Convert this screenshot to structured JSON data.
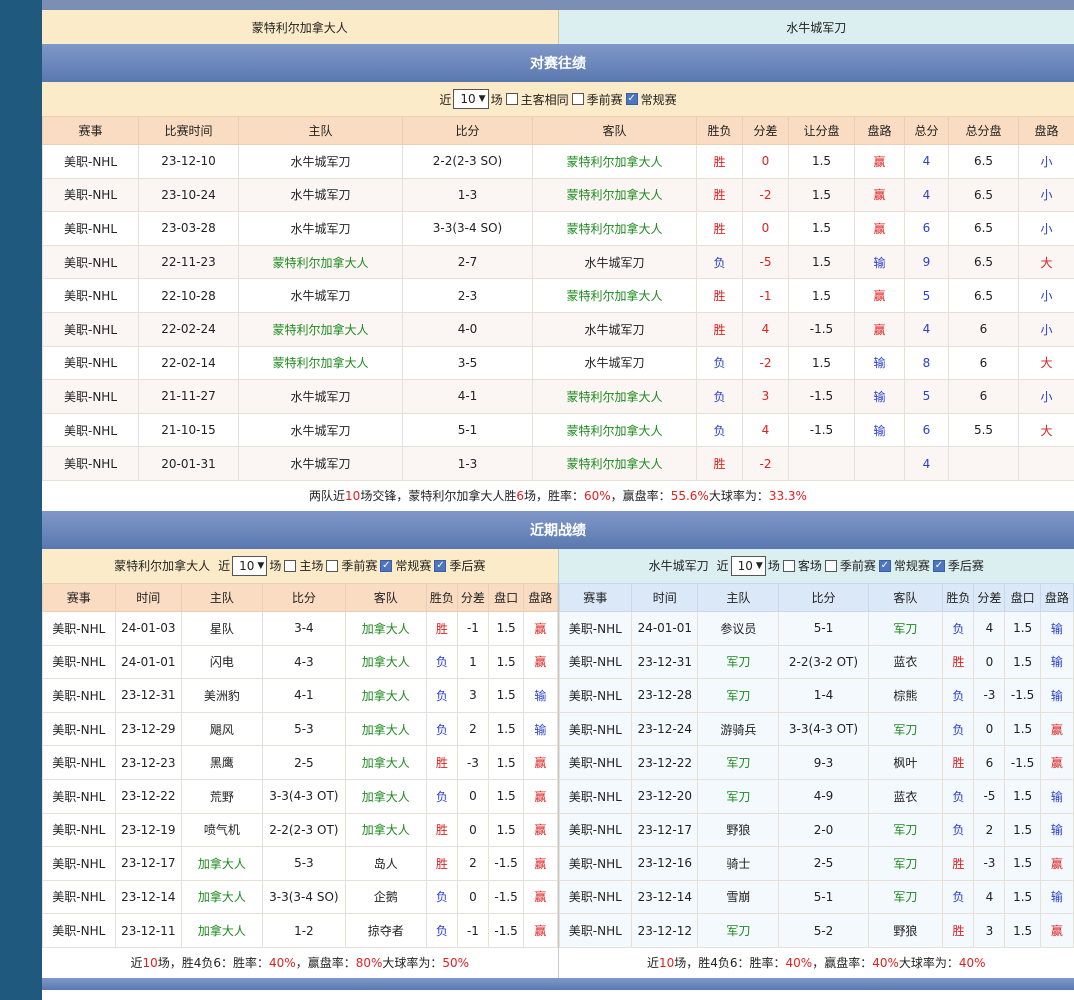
{
  "header": {
    "home": "蒙特利尔加拿大人",
    "away": "水牛城军刀"
  },
  "h2h": {
    "title": "对赛往绩",
    "filter": {
      "prefix": "近",
      "count": "10",
      "suffix": "场",
      "same": "主客相同",
      "pre": "季前赛",
      "regular": "常规赛"
    },
    "columns": [
      "赛事",
      "比赛时间",
      "主队",
      "比分",
      "客队",
      "胜负",
      "分差",
      "让分盘",
      "盘路",
      "总分",
      "总分盘",
      "盘路"
    ],
    "rows": [
      {
        "league": "美职-NHL",
        "date": "23-12-10",
        "home": "水牛城军刀",
        "hc": "",
        "score": "2-2(2-3 SO)",
        "away": "蒙特利尔加拿大人",
        "ac": "g",
        "res": "胜",
        "rc": "r",
        "diff": "0",
        "dc": "r",
        "line": "1.5",
        "pan": "赢",
        "pc": "r",
        "total": "4",
        "tl": "6.5",
        "ou": "小",
        "oc": "b"
      },
      {
        "league": "美职-NHL",
        "date": "23-10-24",
        "home": "水牛城军刀",
        "hc": "",
        "score": "1-3",
        "away": "蒙特利尔加拿大人",
        "ac": "g",
        "res": "胜",
        "rc": "r",
        "diff": "-2",
        "dc": "r",
        "line": "1.5",
        "pan": "赢",
        "pc": "r",
        "total": "4",
        "tl": "6.5",
        "ou": "小",
        "oc": "b"
      },
      {
        "league": "美职-NHL",
        "date": "23-03-28",
        "home": "水牛城军刀",
        "hc": "",
        "score": "3-3(3-4 SO)",
        "away": "蒙特利尔加拿大人",
        "ac": "g",
        "res": "胜",
        "rc": "r",
        "diff": "0",
        "dc": "r",
        "line": "1.5",
        "pan": "赢",
        "pc": "r",
        "total": "6",
        "tl": "6.5",
        "ou": "小",
        "oc": "b"
      },
      {
        "league": "美职-NHL",
        "date": "22-11-23",
        "home": "蒙特利尔加拿大人",
        "hc": "g",
        "score": "2-7",
        "away": "水牛城军刀",
        "ac": "",
        "res": "负",
        "rc": "b",
        "diff": "-5",
        "dc": "r",
        "line": "1.5",
        "pan": "输",
        "pc": "b",
        "total": "9",
        "tl": "6.5",
        "ou": "大",
        "oc": "r"
      },
      {
        "league": "美职-NHL",
        "date": "22-10-28",
        "home": "水牛城军刀",
        "hc": "",
        "score": "2-3",
        "away": "蒙特利尔加拿大人",
        "ac": "g",
        "res": "胜",
        "rc": "r",
        "diff": "-1",
        "dc": "r",
        "line": "1.5",
        "pan": "赢",
        "pc": "r",
        "total": "5",
        "tl": "6.5",
        "ou": "小",
        "oc": "b"
      },
      {
        "league": "美职-NHL",
        "date": "22-02-24",
        "home": "蒙特利尔加拿大人",
        "hc": "g",
        "score": "4-0",
        "away": "水牛城军刀",
        "ac": "",
        "res": "胜",
        "rc": "r",
        "diff": "4",
        "dc": "r",
        "line": "-1.5",
        "pan": "赢",
        "pc": "r",
        "total": "4",
        "tl": "6",
        "ou": "小",
        "oc": "b"
      },
      {
        "league": "美职-NHL",
        "date": "22-02-14",
        "home": "蒙特利尔加拿大人",
        "hc": "g",
        "score": "3-5",
        "away": "水牛城军刀",
        "ac": "",
        "res": "负",
        "rc": "b",
        "diff": "-2",
        "dc": "r",
        "line": "1.5",
        "pan": "输",
        "pc": "b",
        "total": "8",
        "tl": "6",
        "ou": "大",
        "oc": "r"
      },
      {
        "league": "美职-NHL",
        "date": "21-11-27",
        "home": "水牛城军刀",
        "hc": "",
        "score": "4-1",
        "away": "蒙特利尔加拿大人",
        "ac": "g",
        "res": "负",
        "rc": "b",
        "diff": "3",
        "dc": "r",
        "line": "-1.5",
        "pan": "输",
        "pc": "b",
        "total": "5",
        "tl": "6",
        "ou": "小",
        "oc": "b"
      },
      {
        "league": "美职-NHL",
        "date": "21-10-15",
        "home": "水牛城军刀",
        "hc": "",
        "score": "5-1",
        "away": "蒙特利尔加拿大人",
        "ac": "g",
        "res": "负",
        "rc": "b",
        "diff": "4",
        "dc": "r",
        "line": "-1.5",
        "pan": "输",
        "pc": "b",
        "total": "6",
        "tl": "5.5",
        "ou": "大",
        "oc": "r"
      },
      {
        "league": "美职-NHL",
        "date": "20-01-31",
        "home": "水牛城军刀",
        "hc": "",
        "score": "1-3",
        "away": "蒙特利尔加拿大人",
        "ac": "g",
        "res": "胜",
        "rc": "r",
        "diff": "-2",
        "dc": "r",
        "line": "",
        "pan": "",
        "pc": "",
        "total": "4",
        "tl": "",
        "ou": "",
        "oc": ""
      }
    ],
    "summary": {
      "a": "两队近",
      "n": "10",
      "b": "场交锋，蒙特利尔加拿大人胜",
      "w": "6",
      "c": "场，胜率：",
      "wr": "60%",
      "d": "，赢盘率：",
      "pr": "55.6%",
      "e": " 大球率为：",
      "br": "33.3%"
    }
  },
  "recent": {
    "title": "近期战绩",
    "columns": [
      "赛事",
      "时间",
      "主队",
      "比分",
      "客队",
      "胜负",
      "分差",
      "盘口",
      "盘路"
    ],
    "home": {
      "filter": {
        "team": "蒙特利尔加拿大人",
        "prefix": "近",
        "count": "10",
        "suffix": "场",
        "venue": "主场",
        "pre": "季前赛",
        "regular": "常规赛",
        "post": "季后赛"
      },
      "rows": [
        {
          "league": "美职-NHL",
          "date": "24-01-03",
          "home": "星队",
          "hc": "",
          "score": "3-4",
          "away": "加拿大人",
          "ac": "g",
          "res": "胜",
          "rc": "r",
          "diff": "-1",
          "line": "1.5",
          "pan": "赢",
          "pc": "r"
        },
        {
          "league": "美职-NHL",
          "date": "24-01-01",
          "home": "闪电",
          "hc": "",
          "score": "4-3",
          "away": "加拿大人",
          "ac": "g",
          "res": "负",
          "rc": "b",
          "diff": "1",
          "line": "1.5",
          "pan": "赢",
          "pc": "r"
        },
        {
          "league": "美职-NHL",
          "date": "23-12-31",
          "home": "美洲豹",
          "hc": "",
          "score": "4-1",
          "away": "加拿大人",
          "ac": "g",
          "res": "负",
          "rc": "b",
          "diff": "3",
          "line": "1.5",
          "pan": "输",
          "pc": "b"
        },
        {
          "league": "美职-NHL",
          "date": "23-12-29",
          "home": "飓风",
          "hc": "",
          "score": "5-3",
          "away": "加拿大人",
          "ac": "g",
          "res": "负",
          "rc": "b",
          "diff": "2",
          "line": "1.5",
          "pan": "输",
          "pc": "b"
        },
        {
          "league": "美职-NHL",
          "date": "23-12-23",
          "home": "黑鹰",
          "hc": "",
          "score": "2-5",
          "away": "加拿大人",
          "ac": "g",
          "res": "胜",
          "rc": "r",
          "diff": "-3",
          "line": "1.5",
          "pan": "赢",
          "pc": "r"
        },
        {
          "league": "美职-NHL",
          "date": "23-12-22",
          "home": "荒野",
          "hc": "",
          "score": "3-3(4-3 OT)",
          "away": "加拿大人",
          "ac": "g",
          "res": "负",
          "rc": "b",
          "diff": "0",
          "line": "1.5",
          "pan": "赢",
          "pc": "r"
        },
        {
          "league": "美职-NHL",
          "date": "23-12-19",
          "home": "喷气机",
          "hc": "",
          "score": "2-2(2-3 OT)",
          "away": "加拿大人",
          "ac": "g",
          "res": "胜",
          "rc": "r",
          "diff": "0",
          "line": "1.5",
          "pan": "赢",
          "pc": "r"
        },
        {
          "league": "美职-NHL",
          "date": "23-12-17",
          "home": "加拿大人",
          "hc": "g",
          "score": "5-3",
          "away": "岛人",
          "ac": "",
          "res": "胜",
          "rc": "r",
          "diff": "2",
          "line": "-1.5",
          "pan": "赢",
          "pc": "r"
        },
        {
          "league": "美职-NHL",
          "date": "23-12-14",
          "home": "加拿大人",
          "hc": "g",
          "score": "3-3(3-4 SO)",
          "away": "企鹅",
          "ac": "",
          "res": "负",
          "rc": "b",
          "diff": "0",
          "line": "-1.5",
          "pan": "赢",
          "pc": "r"
        },
        {
          "league": "美职-NHL",
          "date": "23-12-11",
          "home": "加拿大人",
          "hc": "g",
          "score": "1-2",
          "away": "掠夺者",
          "ac": "",
          "res": "负",
          "rc": "b",
          "diff": "-1",
          "line": "-1.5",
          "pan": "赢",
          "pc": "r"
        }
      ],
      "summary": {
        "a": "近",
        "n": "10",
        "b": "场，胜4负6：胜率：",
        "wr": "40%",
        "c": "，赢盘率：",
        "pr": "80%",
        "d": " 大球率为：",
        "br": "50%"
      }
    },
    "away": {
      "filter": {
        "team": "水牛城军刀",
        "prefix": "近",
        "count": "10",
        "suffix": "场",
        "venue": "客场",
        "pre": "季前赛",
        "regular": "常规赛",
        "post": "季后赛"
      },
      "rows": [
        {
          "league": "美职-NHL",
          "date": "24-01-01",
          "home": "参议员",
          "hc": "",
          "score": "5-1",
          "away": "军刀",
          "ac": "g",
          "res": "负",
          "rc": "b",
          "diff": "4",
          "line": "1.5",
          "pan": "输",
          "pc": "b"
        },
        {
          "league": "美职-NHL",
          "date": "23-12-31",
          "home": "军刀",
          "hc": "g",
          "score": "2-2(3-2 OT)",
          "away": "蓝衣",
          "ac": "",
          "res": "胜",
          "rc": "r",
          "diff": "0",
          "line": "1.5",
          "pan": "输",
          "pc": "b"
        },
        {
          "league": "美职-NHL",
          "date": "23-12-28",
          "home": "军刀",
          "hc": "g",
          "score": "1-4",
          "away": "棕熊",
          "ac": "",
          "res": "负",
          "rc": "b",
          "diff": "-3",
          "line": "-1.5",
          "pan": "输",
          "pc": "b"
        },
        {
          "league": "美职-NHL",
          "date": "23-12-24",
          "home": "游骑兵",
          "hc": "",
          "score": "3-3(4-3 OT)",
          "away": "军刀",
          "ac": "g",
          "res": "负",
          "rc": "b",
          "diff": "0",
          "line": "1.5",
          "pan": "赢",
          "pc": "r"
        },
        {
          "league": "美职-NHL",
          "date": "23-12-22",
          "home": "军刀",
          "hc": "g",
          "score": "9-3",
          "away": "枫叶",
          "ac": "",
          "res": "胜",
          "rc": "r",
          "diff": "6",
          "line": "-1.5",
          "pan": "赢",
          "pc": "r"
        },
        {
          "league": "美职-NHL",
          "date": "23-12-20",
          "home": "军刀",
          "hc": "g",
          "score": "4-9",
          "away": "蓝衣",
          "ac": "",
          "res": "负",
          "rc": "b",
          "diff": "-5",
          "line": "1.5",
          "pan": "输",
          "pc": "b"
        },
        {
          "league": "美职-NHL",
          "date": "23-12-17",
          "home": "野狼",
          "hc": "",
          "score": "2-0",
          "away": "军刀",
          "ac": "g",
          "res": "负",
          "rc": "b",
          "diff": "2",
          "line": "1.5",
          "pan": "输",
          "pc": "b"
        },
        {
          "league": "美职-NHL",
          "date": "23-12-16",
          "home": "骑士",
          "hc": "",
          "score": "2-5",
          "away": "军刀",
          "ac": "g",
          "res": "胜",
          "rc": "r",
          "diff": "-3",
          "line": "1.5",
          "pan": "赢",
          "pc": "r"
        },
        {
          "league": "美职-NHL",
          "date": "23-12-14",
          "home": "雪崩",
          "hc": "",
          "score": "5-1",
          "away": "军刀",
          "ac": "g",
          "res": "负",
          "rc": "b",
          "diff": "4",
          "line": "1.5",
          "pan": "输",
          "pc": "b"
        },
        {
          "league": "美职-NHL",
          "date": "23-12-12",
          "home": "军刀",
          "hc": "g",
          "score": "5-2",
          "away": "野狼",
          "ac": "",
          "res": "胜",
          "rc": "r",
          "diff": "3",
          "line": "1.5",
          "pan": "赢",
          "pc": "r"
        }
      ],
      "summary": {
        "a": "近",
        "n": "10",
        "b": "场，胜4负6：胜率：",
        "wr": "40%",
        "c": "，赢盘率：",
        "pr": "40%",
        "d": " 大球率为：",
        "br": "40%"
      }
    }
  },
  "colors": {
    "win": "#e02020",
    "loss": "#2a3fd0",
    "team": "#1d8a1d",
    "section": "#6a86bc"
  }
}
